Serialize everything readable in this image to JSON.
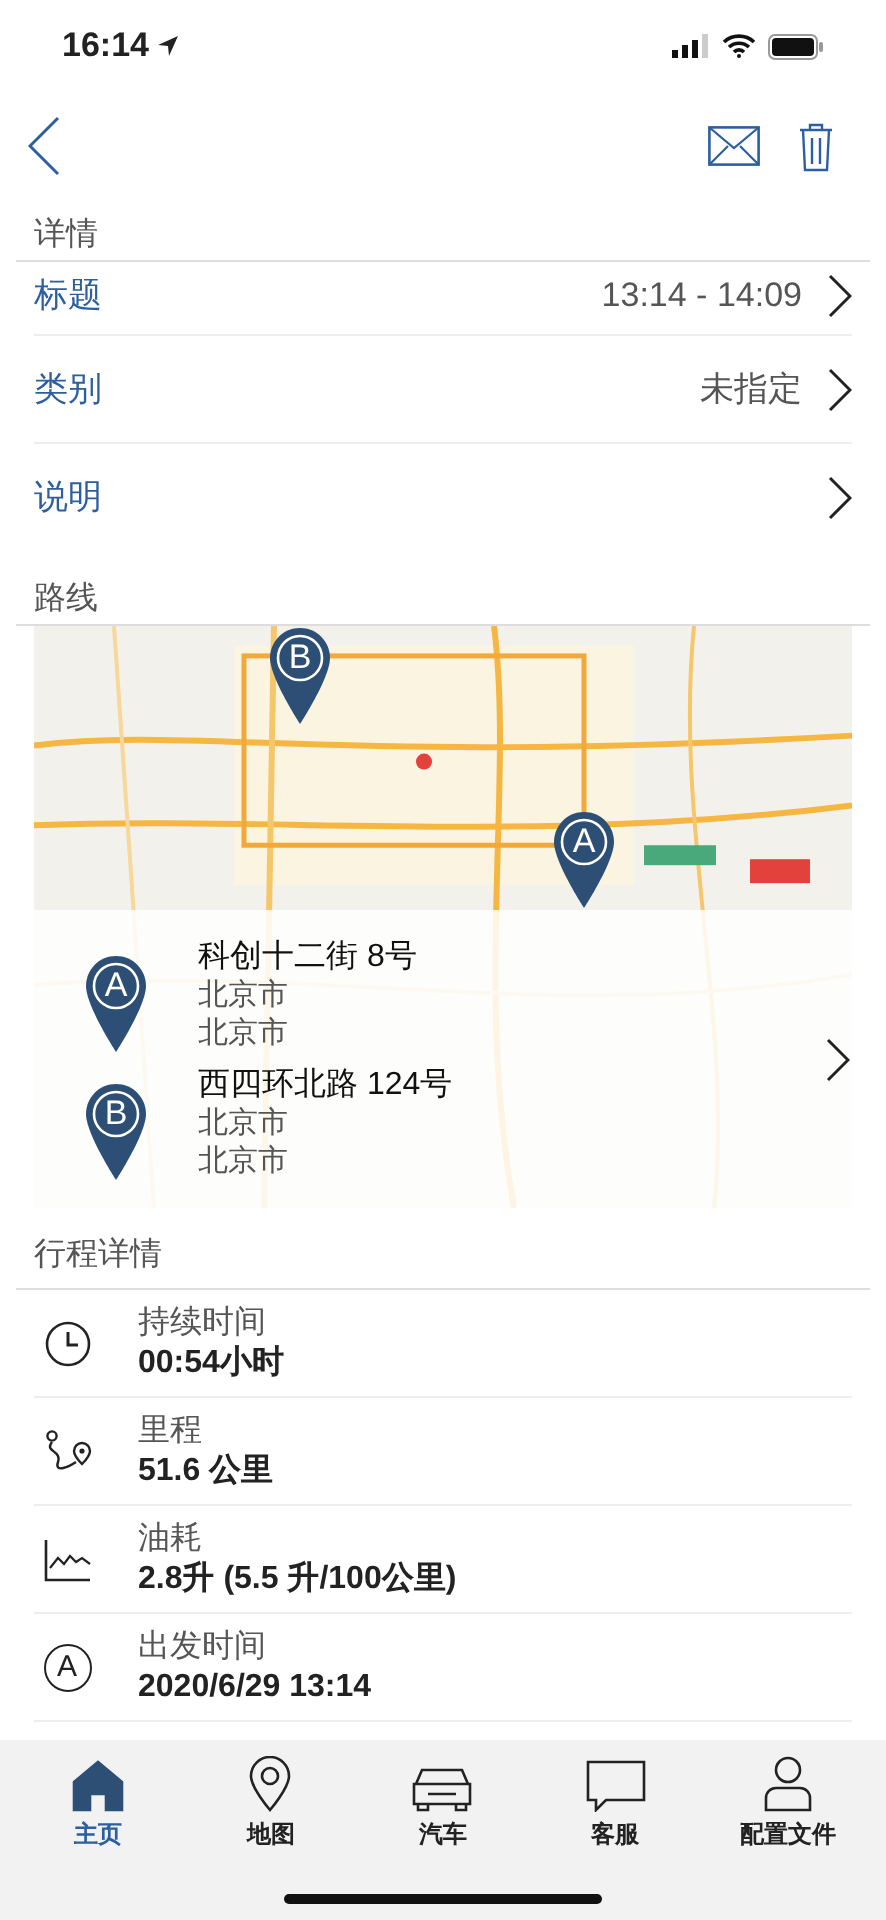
{
  "status_bar": {
    "time": "16:14"
  },
  "details": {
    "header": "详情",
    "rows": [
      {
        "label": "标题",
        "value": "13:14 - 14:09"
      },
      {
        "label": "类别",
        "value": "未指定"
      },
      {
        "label": "说明"
      }
    ]
  },
  "route": {
    "header": "路线",
    "map_pins": [
      {
        "letter": "B",
        "kind": "top"
      },
      {
        "letter": "A",
        "kind": "right"
      }
    ],
    "stops": [
      {
        "letter": "A",
        "street": "科创十二街 8号",
        "city": "北京市",
        "region": "北京市"
      },
      {
        "letter": "B",
        "street": "西四环北路 124号",
        "city": "北京市",
        "region": "北京市"
      }
    ]
  },
  "trip": {
    "header": "行程详情",
    "rows": [
      {
        "kind": "duration",
        "label": "持续时间",
        "value": "00:54小时"
      },
      {
        "kind": "distance",
        "label": "里程",
        "value": "51.6 公里"
      },
      {
        "kind": "fuel",
        "label": "油耗",
        "value": "2.8升 (5.5 升/100公里)"
      },
      {
        "kind": "start",
        "label": "出发时间",
        "value": "2020/6/29 13:14",
        "letter": "A"
      }
    ]
  },
  "tabs": [
    {
      "label": "主页",
      "kind": "home",
      "selected": true
    },
    {
      "label": "地图",
      "kind": "map",
      "selected": false
    },
    {
      "label": "汽车",
      "kind": "car",
      "selected": false
    },
    {
      "label": "客服",
      "kind": "chat",
      "selected": false
    },
    {
      "label": "配置文件",
      "kind": "profile",
      "selected": false
    }
  ]
}
